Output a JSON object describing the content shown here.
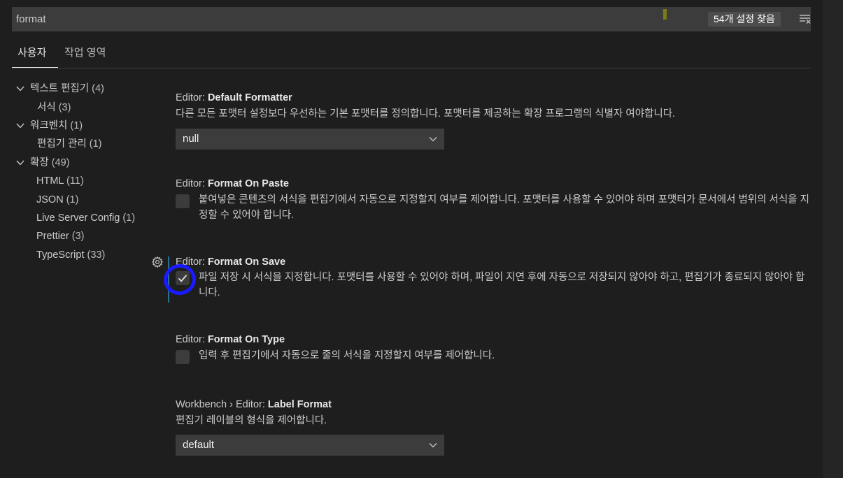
{
  "search": {
    "value": "format",
    "count_label": "54개 설정 찾음",
    "clear_icon": "clear-filter-icon"
  },
  "tabs": [
    {
      "label": "사용자",
      "active": true
    },
    {
      "label": "작업 영역",
      "active": false
    }
  ],
  "toc": [
    {
      "label": "텍스트 편집기",
      "count": "(4)",
      "expanded": true,
      "level": 0
    },
    {
      "label": "서식",
      "count": "(3)",
      "level": 1
    },
    {
      "label": "워크벤치",
      "count": "(1)",
      "expanded": true,
      "level": 0
    },
    {
      "label": "편집기 관리",
      "count": "(1)",
      "level": 1
    },
    {
      "label": "확장",
      "count": "(49)",
      "expanded": true,
      "level": 0
    },
    {
      "label": "HTML",
      "count": "(11)",
      "level": 1
    },
    {
      "label": "JSON",
      "count": "(1)",
      "level": 1
    },
    {
      "label": "Live Server Config",
      "count": "(1)",
      "level": 1
    },
    {
      "label": "Prettier",
      "count": "(3)",
      "level": 1
    },
    {
      "label": "TypeScript",
      "count": "(33)",
      "level": 1
    }
  ],
  "settings": [
    {
      "category": "Editor: ",
      "name": "Default Formatter",
      "description": "다른 모든 포맷터 설정보다 우선하는 기본 포맷터를 정의합니다. 포맷터를 제공하는 확장 프로그램의 식별자 여야합니다.",
      "type": "select",
      "value": "null"
    },
    {
      "category": "Editor: ",
      "name": "Format On Paste",
      "description": "붙여넣은 콘텐츠의 서식을 편집기에서 자동으로 지정할지 여부를 제어합니다. 포맷터를 사용할 수 있어야 하며 포맷터가 문서에서 범위의 서식을 지정할 수 있어야 합니다.",
      "type": "checkbox",
      "checked": false
    },
    {
      "category": "Editor: ",
      "name": "Format On Save",
      "description": "파일 저장 시 서식을 지정합니다. 포맷터를 사용할 수 있어야 하며, 파일이 지연 후에 자동으로 저장되지 않아야 하고, 편집기가 종료되지 않아야 합니다.",
      "type": "checkbox",
      "checked": true
    },
    {
      "category": "Editor: ",
      "name": "Format On Type",
      "description": "입력 후 편집기에서 자동으로 줄의 서식을 지정할지 여부를 제어합니다.",
      "type": "checkbox",
      "checked": false
    },
    {
      "category": "Workbench › Editor: ",
      "name": "Label Format",
      "description": "편집기 레이블의 형식을 제어합니다.",
      "type": "select",
      "value": "default"
    }
  ],
  "colors": {
    "background": "#1e1e1e",
    "input_background": "#3c3c3c",
    "annotation_circle": "#1a1aff",
    "focus_bar": "#2d6f8f"
  }
}
